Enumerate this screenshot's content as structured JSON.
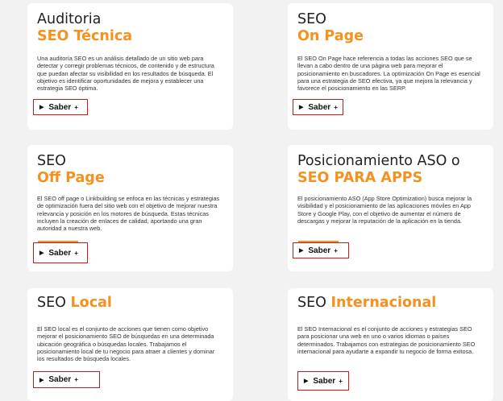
{
  "cards": [
    {
      "title_line1": "Auditoria",
      "title_line2": "SEO Técnica",
      "description": "Una auditoría SEO es un análisis detallado de un sitio web para detectar y corregir problemas técnicos, de contenido y de estructura que puedan afectar su visibilidad en los resultados de búsqueda. El objetivo es identificar oportunidades de mejora y establecer una estrategia SEO óptima.",
      "button_label": "Saber",
      "button_plus": "+"
    },
    {
      "title_line1": "SEO",
      "title_line2": "On Page",
      "description": "El SEO On Page hace referencia a todas las acciones SEO que se llevan a cabo dentro de una página web para mejorar el posicionamiento en buscadores. La optimización On Page es esencial para una estrategia de SEO efectiva, ya que mejora la relevancia y favorece el posicionamiento en las SERP.",
      "button_label": "Saber",
      "button_plus": "+"
    },
    {
      "title_line1": "SEO",
      "title_line2": "Off Page",
      "description": "El SEO off page o Linkbuilding se enfoca en las técnicas y estrategias de optimización fuera del sitio web con el objetivo de mejorar nuestra relevancia y posición en los motores de búsqueda. Estas técnicas incluyen la creación de enlaces de calidad, aportando una gran autoridad a nuestra web.",
      "button_label": "Saber",
      "button_plus": "+"
    },
    {
      "title_line1": "Posicionamiento ASO o",
      "title_line2": "SEO PARA APPS",
      "description": "El posicionamiento ASO (App Store Optimization) busca mejorar la visibilidad y el posicionamiento de las aplicaciones móviles en App Store y Google Play, con el objetivo de aumentar el número de descargas y mejorar la reputación de la aplicación en la tienda.",
      "button_label": "Saber",
      "button_plus": "+"
    },
    {
      "title_plain": "SEO ",
      "title_accent": "Local",
      "description": "El SEO local es el conjunto de acciones que tienen como objetivo mejorar el posicionamiento SEO de búsquedas en una determinada ubicación geográfica o búsquedas locales. Trabajamos el posicionamiento local de tu negocio para atraer a clientes y dominar los resultados de búsqueda locales.",
      "button_label": "Saber",
      "button_plus": "+"
    },
    {
      "title_plain": "SEO ",
      "title_accent": "Internacional",
      "description": "El SEO Internacional es el conjunto de acciones y estrategias SEO para posicionar una web en uno o varios idiomas o países determinados. Trabajamos con estrategias de posicionamiento SEO internacional para ayudarte a expandir tu negocio de forma exitosa.",
      "button_label": "Saber",
      "button_plus": "+"
    }
  ],
  "colors": {
    "accent": "#f5911e",
    "highlight_border": "#d41717",
    "background": "#f2f2f2",
    "card": "#ffffff"
  },
  "icons": {
    "button_icon": "triangle-right-icon"
  }
}
